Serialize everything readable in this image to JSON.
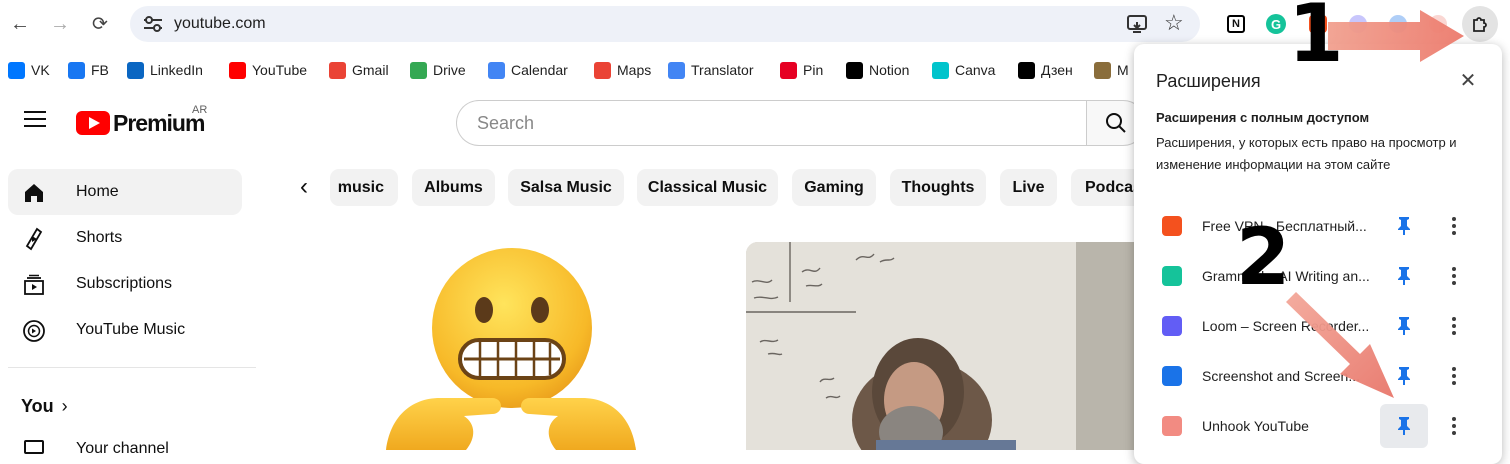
{
  "browser": {
    "url": "youtube.com",
    "toolbar_icons": [
      "cast-icon",
      "bookmark-star-icon",
      "notion-ext-icon",
      "grammarly-ext-icon",
      "vpn-ext-icon",
      "puzzle-extensions-icon"
    ]
  },
  "bookmarks": [
    {
      "label": "VK",
      "icon": "vk-icon",
      "color": "#0077ff"
    },
    {
      "label": "FB",
      "icon": "facebook-icon",
      "color": "#1877f2"
    },
    {
      "label": "LinkedIn",
      "icon": "linkedin-icon",
      "color": "#0a66c2"
    },
    {
      "label": "YouTube",
      "icon": "youtube-icon",
      "color": "#ff0000"
    },
    {
      "label": "Gmail",
      "icon": "gmail-icon",
      "color": "#ea4335"
    },
    {
      "label": "Drive",
      "icon": "drive-icon",
      "color": "#34a853"
    },
    {
      "label": "Calendar",
      "icon": "calendar-icon",
      "color": "#4285f4"
    },
    {
      "label": "Maps",
      "icon": "maps-icon",
      "color": "#ea4335"
    },
    {
      "label": "Translator",
      "icon": "translator-icon",
      "color": "#4285f4"
    },
    {
      "label": "Pin",
      "icon": "pinterest-icon",
      "color": "#e60023"
    },
    {
      "label": "Notion",
      "icon": "notion-icon",
      "color": "#000000"
    },
    {
      "label": "Canva",
      "icon": "canva-icon",
      "color": "#00c4cc"
    },
    {
      "label": "Дзен",
      "icon": "dzen-icon",
      "color": "#000000"
    },
    {
      "label": "M",
      "icon": "bookmark-image-icon",
      "color": "#8a6d3b"
    }
  ],
  "youtube": {
    "logo_text": "Premium",
    "logo_region": "AR",
    "search_placeholder": "Search",
    "sidebar": [
      {
        "label": "Home",
        "icon": "home-icon"
      },
      {
        "label": "Shorts",
        "icon": "shorts-icon"
      },
      {
        "label": "Subscriptions",
        "icon": "subscriptions-icon"
      },
      {
        "label": "YouTube Music",
        "icon": "youtube-music-icon"
      }
    ],
    "you_label": "You",
    "your_channel": "Your channel",
    "chips": [
      "music",
      "Albums",
      "Salsa Music",
      "Classical Music",
      "Gaming",
      "Thoughts",
      "Live",
      "Podcasts"
    ]
  },
  "extensions_panel": {
    "title": "Расширения",
    "subheading": "Расширения с полным доступом",
    "description": "Расширения, у которых есть право на просмотр и изменение информации на этом сайте",
    "items": [
      {
        "name": "Free VPN - Бесплатный...",
        "icon": "free-vpn-icon",
        "color": "#f4511e"
      },
      {
        "name": "Grammarly: AI Writing an...",
        "icon": "grammarly-icon",
        "color": "#15c39a"
      },
      {
        "name": "Loom – Screen Recorder...",
        "icon": "loom-icon",
        "color": "#625df5"
      },
      {
        "name": "Screenshot and Screen...",
        "icon": "screenshot-icon",
        "color": "#1a73e8"
      },
      {
        "name": "Unhook YouTube",
        "icon": "unhook-icon",
        "color": "#f28b82"
      }
    ]
  },
  "annotations": {
    "step1": "1",
    "step2": "2"
  },
  "colors": {
    "accent_blue": "#1a73e8",
    "youtube_red": "#ff0000",
    "arrow": "#ef8f84"
  }
}
